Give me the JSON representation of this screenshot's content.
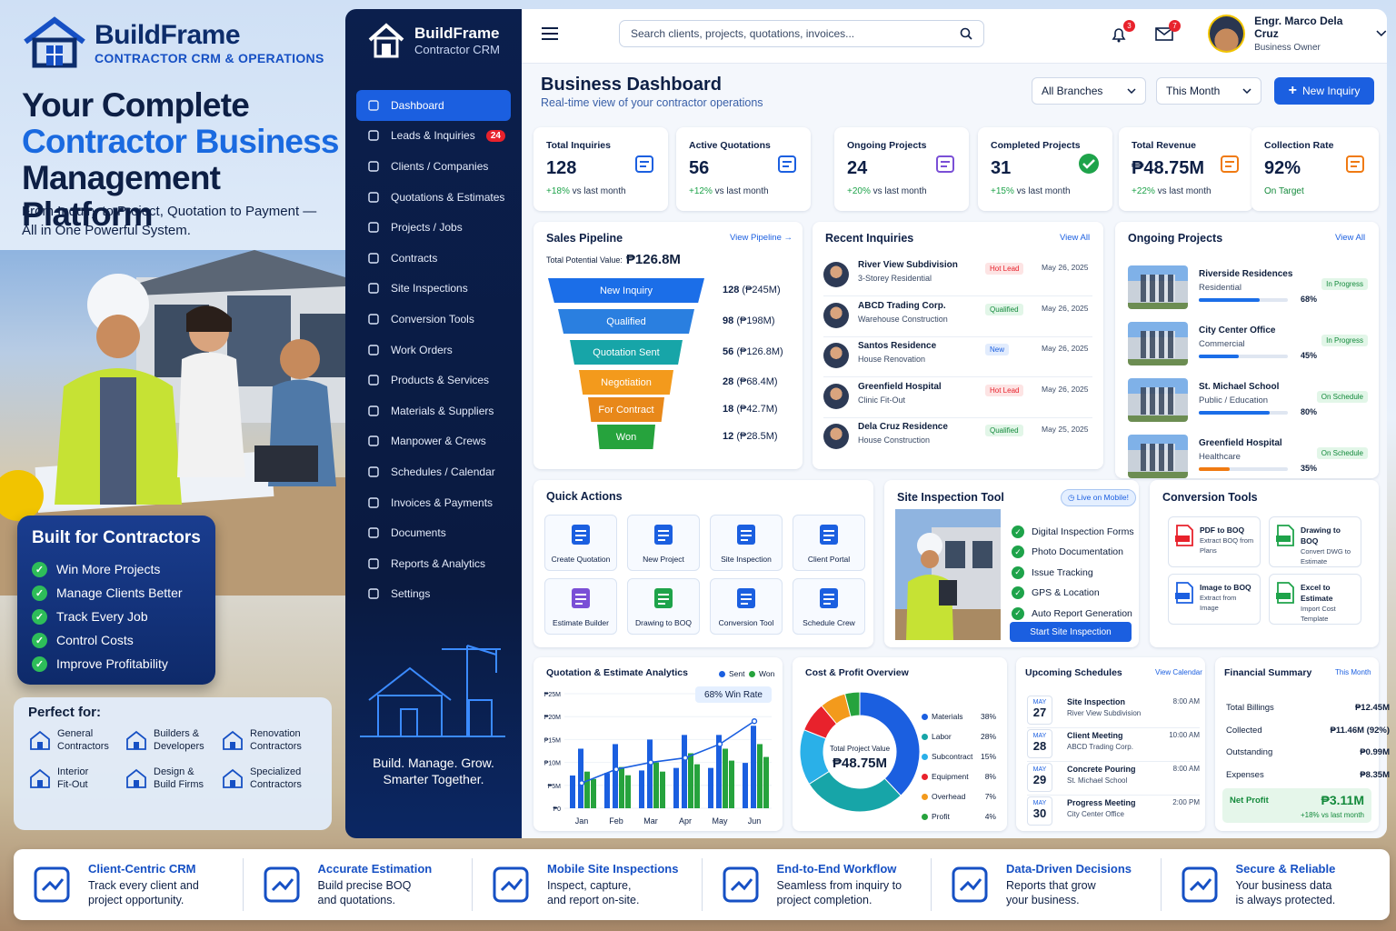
{
  "brand": {
    "name": "BuildFrame",
    "tagline": "CONTRACTOR CRM & OPERATIONS",
    "sidebar_sub": "Contractor CRM"
  },
  "hero": {
    "line1": "Your Complete",
    "line2": "Contractor Business",
    "line3": "Management Platform",
    "sub": "From Inquiry to Project, Quotation to Payment — All in One Powerful System."
  },
  "built": {
    "title": "Built for Contractors",
    "items": [
      "Win More Projects",
      "Manage Clients Better",
      "Track Every Job",
      "Control Costs",
      "Improve Profitability"
    ]
  },
  "perfect": {
    "title": "Perfect for:",
    "items": [
      {
        "l1": "General",
        "l2": "Contractors",
        "icon": "house-icon"
      },
      {
        "l1": "Builders &",
        "l2": "Developers",
        "icon": "building-icon"
      },
      {
        "l1": "Renovation",
        "l2": "Contractors",
        "icon": "tools-icon"
      },
      {
        "l1": "Interior",
        "l2": "Fit-Out",
        "icon": "interior-icon"
      },
      {
        "l1": "Design &",
        "l2": "Build Firms",
        "icon": "design-icon"
      },
      {
        "l1": "Specialized",
        "l2": "Contractors",
        "icon": "specialized-icon"
      }
    ]
  },
  "nav": [
    {
      "label": "Dashboard",
      "icon": "home-icon"
    },
    {
      "label": "Leads & Inquiries",
      "icon": "user-icon",
      "badge": "24"
    },
    {
      "label": "Clients / Companies",
      "icon": "building-icon"
    },
    {
      "label": "Quotations & Estimates",
      "icon": "document-icon"
    },
    {
      "label": "Projects / Jobs",
      "icon": "briefcase-icon"
    },
    {
      "label": "Contracts",
      "icon": "contract-icon"
    },
    {
      "label": "Site Inspections",
      "icon": "search-icon"
    },
    {
      "label": "Conversion Tools",
      "icon": "convert-icon"
    },
    {
      "label": "Work Orders",
      "icon": "wrench-icon"
    },
    {
      "label": "Products & Services",
      "icon": "box-icon"
    },
    {
      "label": "Materials & Suppliers",
      "icon": "materials-icon"
    },
    {
      "label": "Manpower & Crews",
      "icon": "team-icon"
    },
    {
      "label": "Schedules / Calendar",
      "icon": "calendar-icon"
    },
    {
      "label": "Invoices & Payments",
      "icon": "invoice-icon"
    },
    {
      "label": "Documents",
      "icon": "file-icon"
    },
    {
      "label": "Reports & Analytics",
      "icon": "chart-icon"
    },
    {
      "label": "Settings",
      "icon": "gear-icon"
    }
  ],
  "sidebar_motto": {
    "l1": "Build. Manage. Grow.",
    "l2": "Smarter Together."
  },
  "topbar": {
    "search_placeholder": "Search clients, projects, quotations, invoices...",
    "notif_count": "3",
    "mail_count": "7",
    "user_name": "Engr. Marco Dela Cruz",
    "user_role": "Business Owner"
  },
  "dashboard": {
    "title": "Business Dashboard",
    "subtitle": "Real-time view of your contractor operations",
    "branch": "All Branches",
    "period": "This Month",
    "new_btn": "New Inquiry"
  },
  "kpis": [
    {
      "label": "Total Inquiries",
      "value": "128",
      "change": "+18%",
      "suffix": "vs last month",
      "icon": "users-icon"
    },
    {
      "label": "Active Quotations",
      "value": "56",
      "change": "+12%",
      "suffix": "vs last month",
      "icon": "quote-icon"
    },
    {
      "label": "Ongoing Projects",
      "value": "24",
      "change": "+20%",
      "suffix": "vs last month",
      "icon": "calendar-icon"
    },
    {
      "label": "Completed Projects",
      "value": "31",
      "change": "+15%",
      "suffix": "vs last month",
      "icon": "check-icon"
    },
    {
      "label": "Total Revenue",
      "value": "₱48.75M",
      "change": "+22%",
      "suffix": "vs last month",
      "icon": "money-icon"
    },
    {
      "label": "Collection Rate",
      "value": "92%",
      "change": "",
      "suffix": "On Target",
      "icon": "wallet-icon"
    }
  ],
  "pipeline": {
    "title": "Sales Pipeline",
    "link": "View Pipeline →",
    "potential_label": "Total Potential Value:",
    "potential_value": "₱126.8M",
    "stages": [
      {
        "name": "New Inquiry",
        "count": "128",
        "amount": "(₱245M)",
        "color": "#1b6ee8"
      },
      {
        "name": "Qualified",
        "count": "98",
        "amount": "(₱198M)",
        "color": "#2a7fe0"
      },
      {
        "name": "Quotation Sent",
        "count": "56",
        "amount": "(₱126.8M)",
        "color": "#17a5a8"
      },
      {
        "name": "Negotiation",
        "count": "28",
        "amount": "(₱68.4M)",
        "color": "#f39a1c"
      },
      {
        "name": "For Contract",
        "count": "18",
        "amount": "(₱42.7M)",
        "color": "#e8881a"
      },
      {
        "name": "Won",
        "count": "12",
        "amount": "(₱28.5M)",
        "color": "#26a33d"
      }
    ]
  },
  "inquiries": {
    "title": "Recent Inquiries",
    "link": "View All",
    "rows": [
      {
        "name": "River View Subdivision",
        "type": "3-Storey Residential",
        "tag": "Hot Lead",
        "date": "May 26, 2025"
      },
      {
        "name": "ABCD Trading Corp.",
        "type": "Warehouse Construction",
        "tag": "Qualified",
        "date": "May 26, 2025"
      },
      {
        "name": "Santos Residence",
        "type": "House Renovation",
        "tag": "New",
        "date": "May 26, 2025"
      },
      {
        "name": "Greenfield Hospital",
        "type": "Clinic Fit-Out",
        "tag": "Hot Lead",
        "date": "May 26, 2025"
      },
      {
        "name": "Dela Cruz Residence",
        "type": "House Construction",
        "tag": "Qualified",
        "date": "May 25, 2025"
      }
    ]
  },
  "projects": {
    "title": "Ongoing Projects",
    "link": "View All",
    "rows": [
      {
        "name": "Riverside Residences",
        "cat": "Residential",
        "status": "In Progress",
        "pct": "68%",
        "progress": 0.68,
        "color": "#1b6ee8"
      },
      {
        "name": "City Center Office",
        "cat": "Commercial",
        "status": "In Progress",
        "pct": "45%",
        "progress": 0.45,
        "color": "#1b6ee8"
      },
      {
        "name": "St. Michael School",
        "cat": "Public / Education",
        "status": "On Schedule",
        "pct": "80%",
        "progress": 0.8,
        "color": "#1b6ee8"
      },
      {
        "name": "Greenfield Hospital",
        "cat": "Healthcare",
        "status": "On Schedule",
        "pct": "35%",
        "progress": 0.35,
        "color": "#f07a12"
      }
    ]
  },
  "quick": {
    "title": "Quick Actions",
    "items": [
      {
        "label": "Create Quotation",
        "icon": "quotation-icon"
      },
      {
        "label": "New Project",
        "icon": "project-icon"
      },
      {
        "label": "Site Inspection",
        "icon": "inspection-icon"
      },
      {
        "label": "Client Portal",
        "icon": "portal-icon"
      },
      {
        "label": "Estimate Builder",
        "icon": "estimate-icon"
      },
      {
        "label": "Drawing to BOQ",
        "icon": "drawing-icon"
      },
      {
        "label": "Conversion Tool",
        "icon": "conversion-icon"
      },
      {
        "label": "Schedule Crew",
        "icon": "crew-icon"
      }
    ]
  },
  "inspection": {
    "title": "Site Inspection Tool",
    "badge": "Live on Mobile!",
    "features": [
      "Digital Inspection Forms",
      "Photo Documentation",
      "Issue Tracking",
      "GPS & Location",
      "Auto Report Generation"
    ],
    "button": "Start Site Inspection"
  },
  "conversion": {
    "title": "Conversion Tools",
    "items": [
      {
        "t": "PDF to BOQ",
        "d": "Extract BOQ from Plans",
        "icon": "pdf-icon"
      },
      {
        "t": "Drawing to BOQ",
        "d": "Convert DWG to Estimate",
        "icon": "dwg-icon"
      },
      {
        "t": "Image to BOQ",
        "d": "Extract from Image",
        "icon": "image-icon"
      },
      {
        "t": "Excel to Estimate",
        "d": "Import Cost Template",
        "icon": "excel-icon"
      }
    ]
  },
  "chart_data": [
    {
      "type": "bar",
      "title": "Quotation & Estimate Analytics",
      "categories": [
        "Jan",
        "Feb",
        "Mar",
        "Apr",
        "May",
        "Jun"
      ],
      "series": [
        {
          "name": "Sent",
          "values": [
            13,
            14,
            15,
            16,
            16,
            18
          ],
          "color": "#1b5fe0"
        },
        {
          "name": "Won",
          "values": [
            8,
            9,
            10,
            12,
            13,
            14
          ],
          "color": "#26a33d"
        }
      ],
      "line_values": [
        5.5,
        8.5,
        10,
        11,
        14,
        19
      ],
      "ylim": [
        0,
        25
      ],
      "ytick_labels": [
        "₱0",
        "₱5M",
        "₱10M",
        "₱15M",
        "₱20M",
        "₱25M"
      ],
      "annotation": "68% Win Rate"
    },
    {
      "type": "pie",
      "title": "Cost & Profit Overview",
      "center_label": "Total Project Value",
      "center_value": "₱48.75M",
      "slices": [
        {
          "name": "Materials",
          "value": 38,
          "label": "38%",
          "color": "#1b5fe0"
        },
        {
          "name": "Labor",
          "value": 28,
          "label": "28%",
          "color": "#17a5a8"
        },
        {
          "name": "Subcontract",
          "value": 15,
          "label": "15%",
          "color": "#2ab0e8"
        },
        {
          "name": "Equipment",
          "value": 8,
          "label": "8%",
          "color": "#e8222c"
        },
        {
          "name": "Overhead",
          "value": 7,
          "label": "7%",
          "color": "#f39a1c"
        },
        {
          "name": "Profit",
          "value": 4,
          "label": "4%",
          "color": "#26a33d"
        }
      ]
    }
  ],
  "analytics_legend": {
    "sent": "Sent",
    "won": "Won"
  },
  "schedules": {
    "title": "Upcoming Schedules",
    "link": "View Calendar",
    "rows": [
      {
        "mon": "MAY",
        "day": "27",
        "name": "Site Inspection",
        "sub": "River View Subdivision",
        "time": "8:00 AM"
      },
      {
        "mon": "MAY",
        "day": "28",
        "name": "Client Meeting",
        "sub": "ABCD Trading Corp.",
        "time": "10:00 AM"
      },
      {
        "mon": "MAY",
        "day": "29",
        "name": "Concrete Pouring",
        "sub": "St. Michael School",
        "time": "8:00 AM"
      },
      {
        "mon": "MAY",
        "day": "30",
        "name": "Progress Meeting",
        "sub": "City Center Office",
        "time": "2:00 PM"
      }
    ]
  },
  "financial": {
    "title": "Financial Summary",
    "link": "This Month",
    "rows": [
      {
        "k": "Total Billings",
        "v": "₱12.45M"
      },
      {
        "k": "Collected",
        "v": "₱11.46M (92%)"
      },
      {
        "k": "Outstanding",
        "v": "₱0.99M"
      },
      {
        "k": "Expenses",
        "v": "₱8.35M"
      }
    ],
    "profit_label": "Net Profit",
    "profit_value": "₱3.11M",
    "profit_change": "+18% vs last month"
  },
  "footer": [
    {
      "t": "Client-Centric CRM",
      "d1": "Track every client and",
      "d2": "project opportunity.",
      "icon": "handshake-icon"
    },
    {
      "t": "Accurate Estimation",
      "d1": "Build precise BOQ",
      "d2": "and quotations.",
      "icon": "calculator-icon"
    },
    {
      "t": "Mobile Site Inspections",
      "d1": "Inspect, capture,",
      "d2": "and report on-site.",
      "icon": "mobile-icon"
    },
    {
      "t": "End-to-End Workflow",
      "d1": "Seamless from inquiry to",
      "d2": "project completion.",
      "icon": "workflow-icon"
    },
    {
      "t": "Data-Driven Decisions",
      "d1": "Reports that grow",
      "d2": "your business.",
      "icon": "growth-icon"
    },
    {
      "t": "Secure & Reliable",
      "d1": "Your business data",
      "d2": "is always protected.",
      "icon": "shield-icon"
    }
  ]
}
